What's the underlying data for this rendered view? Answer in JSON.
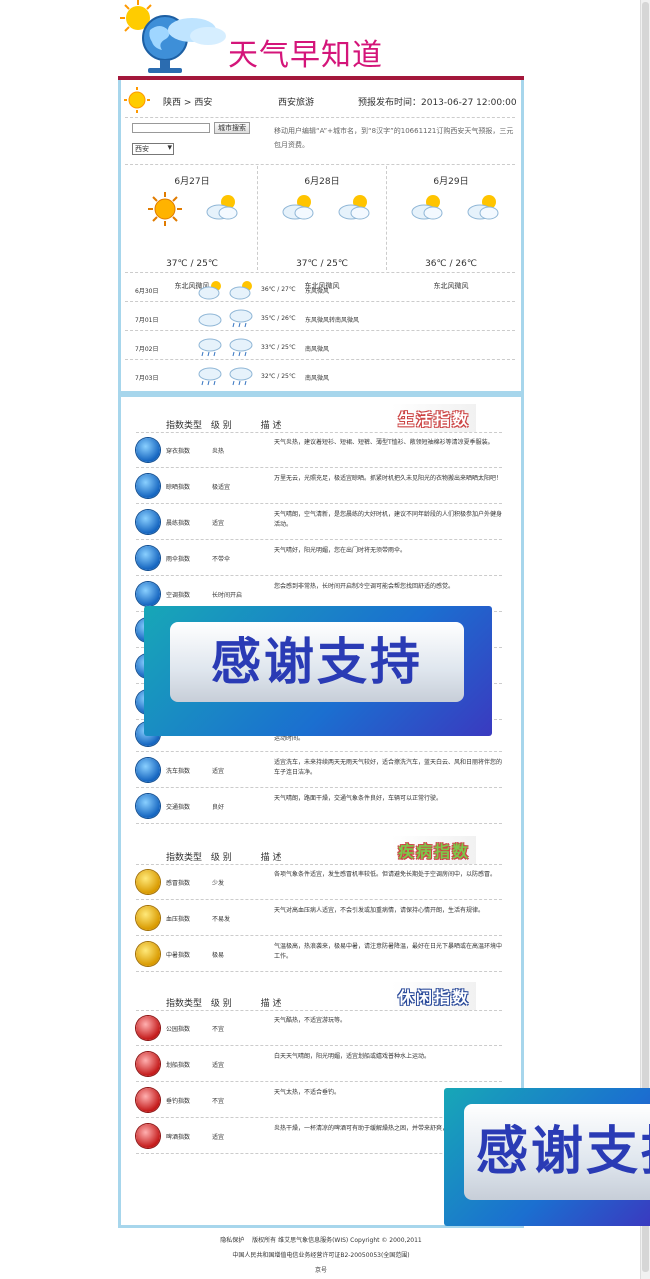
{
  "header": {
    "logo_text": "天气早知道"
  },
  "location": {
    "province": "陕西",
    "separator": ">",
    "city": "西安",
    "travel": "西安旅游",
    "publish": "预报发布时间：2013-06-27 12:00:00"
  },
  "search": {
    "placeholder": "",
    "button": "城市搜索",
    "select_value": "西安"
  },
  "notice": "移动用户编辑“A”+城市名，到“8汉字”的10661121订购西安天气预报，三元包月资费。",
  "days": [
    {
      "date": "6月27日",
      "temp": "37℃ / 25℃",
      "wind": "东北风微风",
      "icons": [
        "sun-icon",
        "cloud-sun-icon"
      ]
    },
    {
      "date": "6月28日",
      "temp": "37℃ / 25℃",
      "wind": "东北风微风",
      "icons": [
        "cloud-sun-icon",
        "cloud-sun-icon"
      ]
    },
    {
      "date": "6月29日",
      "temp": "36℃ / 26℃",
      "wind": "东北风微风",
      "icons": [
        "cloud-sun-icon",
        "cloud-sun-icon"
      ]
    }
  ],
  "forecast": [
    {
      "date": "6月30日",
      "temp": "36℃ / 27℃",
      "wind": "东风微风"
    },
    {
      "date": "7月01日",
      "temp": "35℃ / 26℃",
      "wind": "东风微风转南风微风"
    },
    {
      "date": "7月02日",
      "temp": "33℃ / 25℃",
      "wind": "南风微风"
    },
    {
      "date": "7月03日",
      "temp": "32℃ / 25℃",
      "wind": "南风微风"
    }
  ],
  "index_header": {
    "type": "指数类型",
    "level": "级 别",
    "desc": "描 述"
  },
  "banners": {
    "life": "生活指数",
    "disease": "疾病指数",
    "leisure": "休闲指数"
  },
  "life_index": [
    {
      "name": "穿衣指数",
      "level": "炎热",
      "desc": "天气炎热，建议着短衫、短裙、短裤、薄型T恤衫、敞领短袖棉衫等清凉夏季服装。"
    },
    {
      "name": "晾晒指数",
      "level": "极适宜",
      "desc": "万里无云，光照充足，极适宜晾晒。抓紧时机把久未见阳光的衣物搬出来晒晒太阳吧！"
    },
    {
      "name": "晨练指数",
      "level": "适宜",
      "desc": "天气晴朗，空气清新，是您晨练的大好时机，建议不同年龄段的人们积极参加户外健身活动。"
    },
    {
      "name": "雨伞指数",
      "level": "不带伞",
      "desc": "天气晴好，阳光明媚，您在出门时将无须带雨伞。"
    },
    {
      "name": "空调指数",
      "level": "长时间开启",
      "desc": "您会感到非常热，长时间开启制冷空调可能会帮您找回舒适的感觉。"
    },
    {
      "name": "",
      "level": "",
      "desc": ""
    },
    {
      "name": "",
      "level": "",
      "desc": ""
    },
    {
      "name": "",
      "level": "",
      "desc": ""
    },
    {
      "name": "",
      "level": "",
      "desc": "运动时间。"
    },
    {
      "name": "洗车指数",
      "level": "适宜",
      "desc": "适宜洗车，未来持续两天无雨天气较好，适合擦洗汽车，蓝天白云、风和日丽将伴您的车子连日洁净。"
    },
    {
      "name": "交通指数",
      "level": "良好",
      "desc": "天气晴朗，路面干燥，交通气象条件良好，车辆可以正常行驶。"
    }
  ],
  "disease_index": [
    {
      "name": "感冒指数",
      "level": "少发",
      "desc": "各项气象条件适宜，发生感冒机率较低。但请避免长期处于空调房间中，以防感冒。"
    },
    {
      "name": "血压指数",
      "level": "不易发",
      "desc": "天气对高血压病人适宜，不会引发或加重病情，请保持心情开朗，生活有规律。"
    },
    {
      "name": "中暑指数",
      "level": "极易",
      "desc": "气温极高，热浪袭来，极易中暑，请注意防暑降温，最好在日光下暴晒或在高温环境中工作。"
    }
  ],
  "leisure_index": [
    {
      "name": "公园指数",
      "level": "不宜",
      "desc": "天气酷热，不适宜游玩等。"
    },
    {
      "name": "划船指数",
      "level": "适宜",
      "desc": "白天天气晴朗，阳光明媚，适宜划船或嬉戏普种水上运动。"
    },
    {
      "name": "垂钓指数",
      "level": "不宜",
      "desc": "天气太热，不适合垂钓。"
    },
    {
      "name": "啤酒指数",
      "level": "适宜",
      "desc": "炎热干燥，一杯清凉的啤酒可有助于缓解燥热之困，并带来舒爽，不要贪杯哦！"
    }
  ],
  "overlay_text": "感谢支持",
  "footer": {
    "line1": "隐私保护　 版权所有 维艾思气象信息服务(WIS) Copyright © 2000,2011",
    "line2": "中国人民共和国增值电信业务经营许可证B2-20050053(全国范围)",
    "line3": "京号"
  },
  "colors": {
    "brand": "#d4157a",
    "border": "#a7d6ec",
    "rule": "#a3173b"
  }
}
